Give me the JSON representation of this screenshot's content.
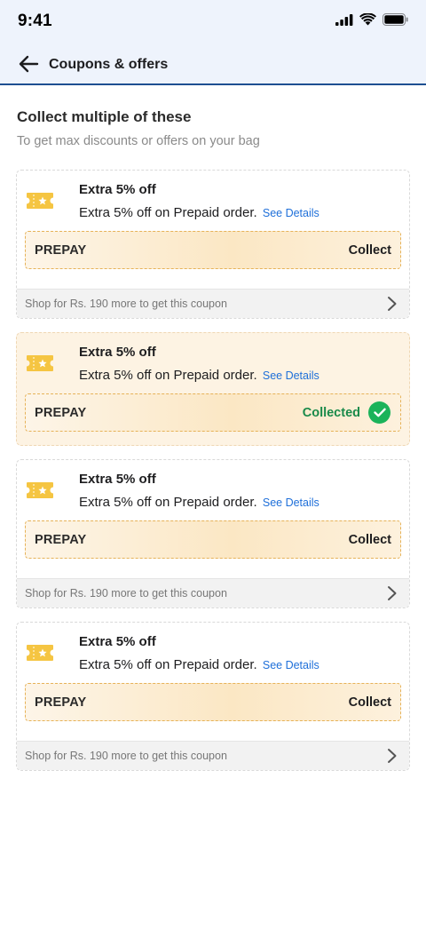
{
  "status_bar": {
    "time": "9:41"
  },
  "header": {
    "title": "Coupons & offers"
  },
  "intro": {
    "title": "Collect multiple of these",
    "subtitle": "To get max discounts or offers on your bag"
  },
  "coupons": [
    {
      "title": "Extra 5% off",
      "description": "Extra 5% off on Prepaid order.",
      "see_details": "See Details",
      "code": "PREPAY",
      "action": "Collect",
      "footer": "Shop for Rs. 190 more to get this coupon"
    },
    {
      "title": "Extra 5% off",
      "description": "Extra 5% off on Prepaid order.",
      "see_details": "See Details",
      "code": "PREPAY",
      "action": "Collected"
    },
    {
      "title": "Extra 5% off",
      "description": "Extra 5% off on Prepaid order.",
      "see_details": "See Details",
      "code": "PREPAY",
      "action": "Collect",
      "footer": "Shop for Rs. 190 more to get this coupon"
    },
    {
      "title": "Extra 5% off",
      "description": "Extra 5% off on Prepaid order.",
      "see_details": "See Details",
      "code": "PREPAY",
      "action": "Collect",
      "footer": "Shop for Rs. 190 more to get this coupon"
    }
  ],
  "colors": {
    "accent_link": "#1e6fd9",
    "success": "#1bb35a",
    "header_rule": "#1d4f91",
    "ticket": "#f5c542"
  }
}
